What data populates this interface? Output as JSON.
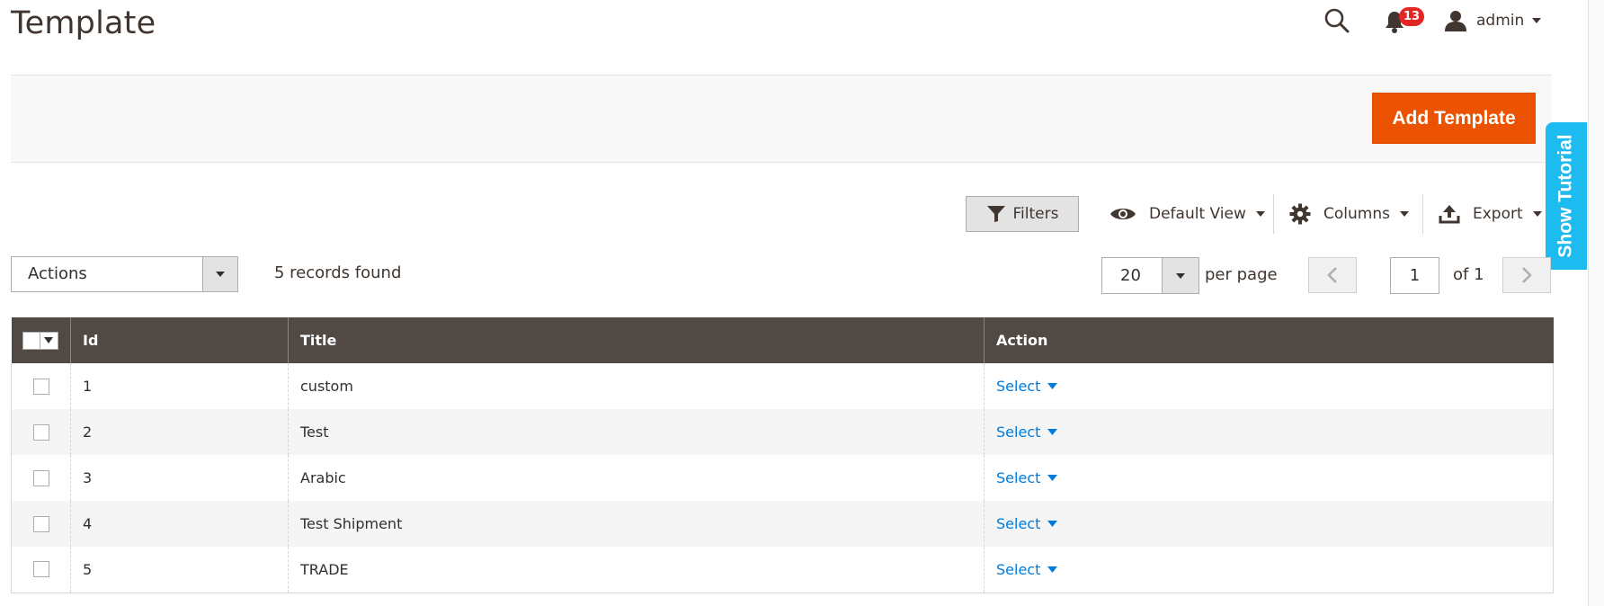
{
  "header": {
    "page_title": "Template",
    "notifications_count": "13",
    "user_name": "admin"
  },
  "actionbar": {
    "add_button_label": "Add Template"
  },
  "tutorial": {
    "label": "Show Tutorial"
  },
  "toolbar": {
    "filters_label": "Filters",
    "view_label": "Default View",
    "columns_label": "Columns",
    "export_label": "Export"
  },
  "listing": {
    "actions_label": "Actions",
    "records_found": "5 records found",
    "per_page_value": "20",
    "per_page_label": "per page",
    "current_page": "1",
    "total_pages_label": "of 1"
  },
  "grid": {
    "columns": [
      "Id",
      "Title",
      "Action"
    ],
    "action_link_label": "Select",
    "rows": [
      {
        "id": "1",
        "title": "custom",
        "action": "Select"
      },
      {
        "id": "2",
        "title": "Test",
        "action": "Select"
      },
      {
        "id": "3",
        "title": "Arabic",
        "action": "Select"
      },
      {
        "id": "4",
        "title": "Test Shipment",
        "action": "Select"
      },
      {
        "id": "5",
        "title": "TRADE",
        "action": "Select"
      }
    ]
  },
  "colors": {
    "accent": "#eb5202",
    "header_bg": "#514943",
    "link": "#007bdb",
    "tutorial": "#1ebbf0",
    "badge": "#e22626"
  },
  "icons": {
    "search": "search-icon",
    "notifications": "bell-icon",
    "user": "user-icon",
    "filter": "filter-icon",
    "view": "eye-icon",
    "columns": "gear-icon",
    "export": "upload-icon"
  }
}
